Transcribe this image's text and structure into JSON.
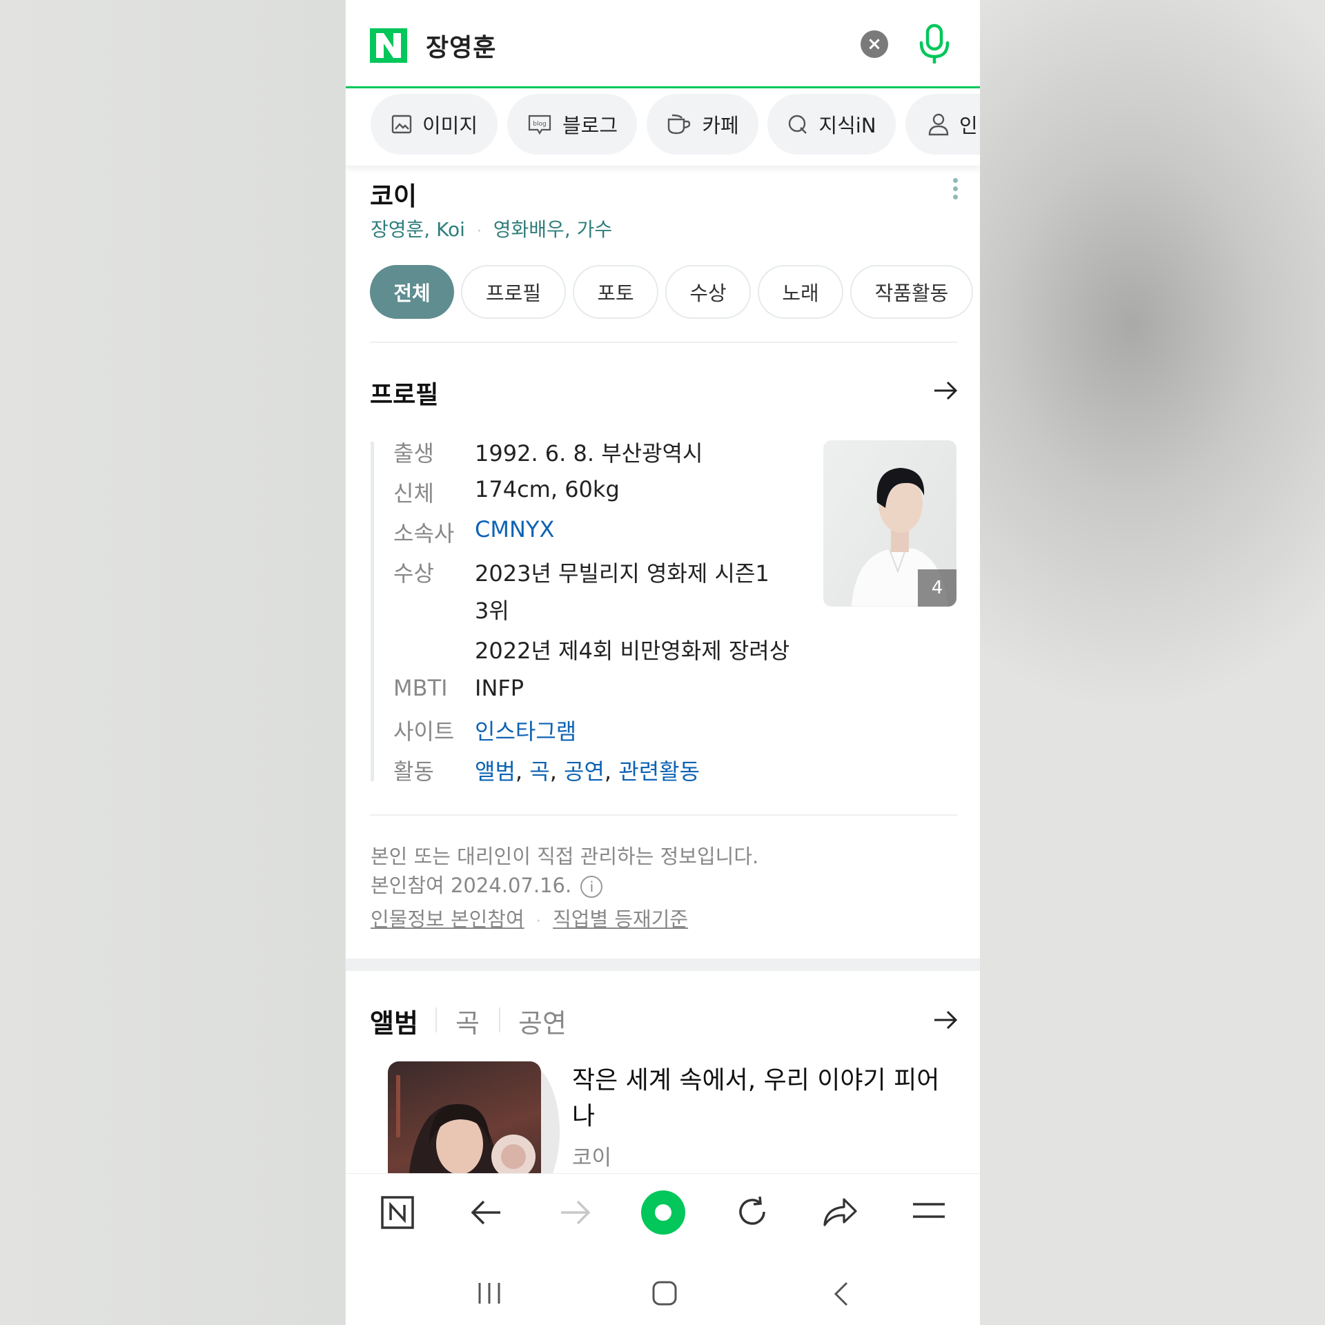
{
  "search": {
    "query": "장영훈",
    "clear_icon": "×"
  },
  "categories": [
    "이미지",
    "블로그",
    "카페",
    "지식iN",
    "인"
  ],
  "person": {
    "name": "코이",
    "aliases": "장영훈, Koi",
    "separator": "·",
    "roles": "영화배우, 가수"
  },
  "tabs": [
    "전체",
    "프로필",
    "포토",
    "수상",
    "노래",
    "작품활동"
  ],
  "active_tab": "전체",
  "profile": {
    "title": "프로필",
    "rows": {
      "birth": {
        "label": "출생",
        "value": "1992. 6. 8. 부산광역시"
      },
      "body": {
        "label": "신체",
        "value": "174cm, 60kg"
      },
      "agency": {
        "label": "소속사",
        "value": "CMNYX"
      },
      "awards": {
        "label": "수상",
        "line1": "2023년 무빌리지 영화제 시즌1",
        "line2": "3위",
        "line3": "2022년 제4회 비만영화제 장려상"
      },
      "mbti": {
        "label": "MBTI",
        "value": "INFP"
      },
      "site": {
        "label": "사이트",
        "value": "인스타그램"
      },
      "activity": {
        "label": "활동",
        "links": [
          "앨범",
          "곡",
          "공연",
          "관련활동"
        ],
        "comma": ", "
      }
    },
    "photo_count": "4"
  },
  "footer_note": {
    "line1": "본인 또는 대리인이 직접 관리하는 정보입니다.",
    "line2": "본인참여 2024.07.16.",
    "link1": "인물정보 본인참여",
    "link2": "직업별 등재기준",
    "info_icon": "i"
  },
  "music": {
    "tabs": [
      "앨범",
      "곡",
      "공연"
    ],
    "album_title": "작은 세계 속에서, 우리 이야기 피어나",
    "album_artist": "코이"
  },
  "colors": {
    "brand": "#03c75a",
    "active_tab": "#5f8d90",
    "link": "#0d63b4",
    "alias": "#2e7d7b"
  }
}
